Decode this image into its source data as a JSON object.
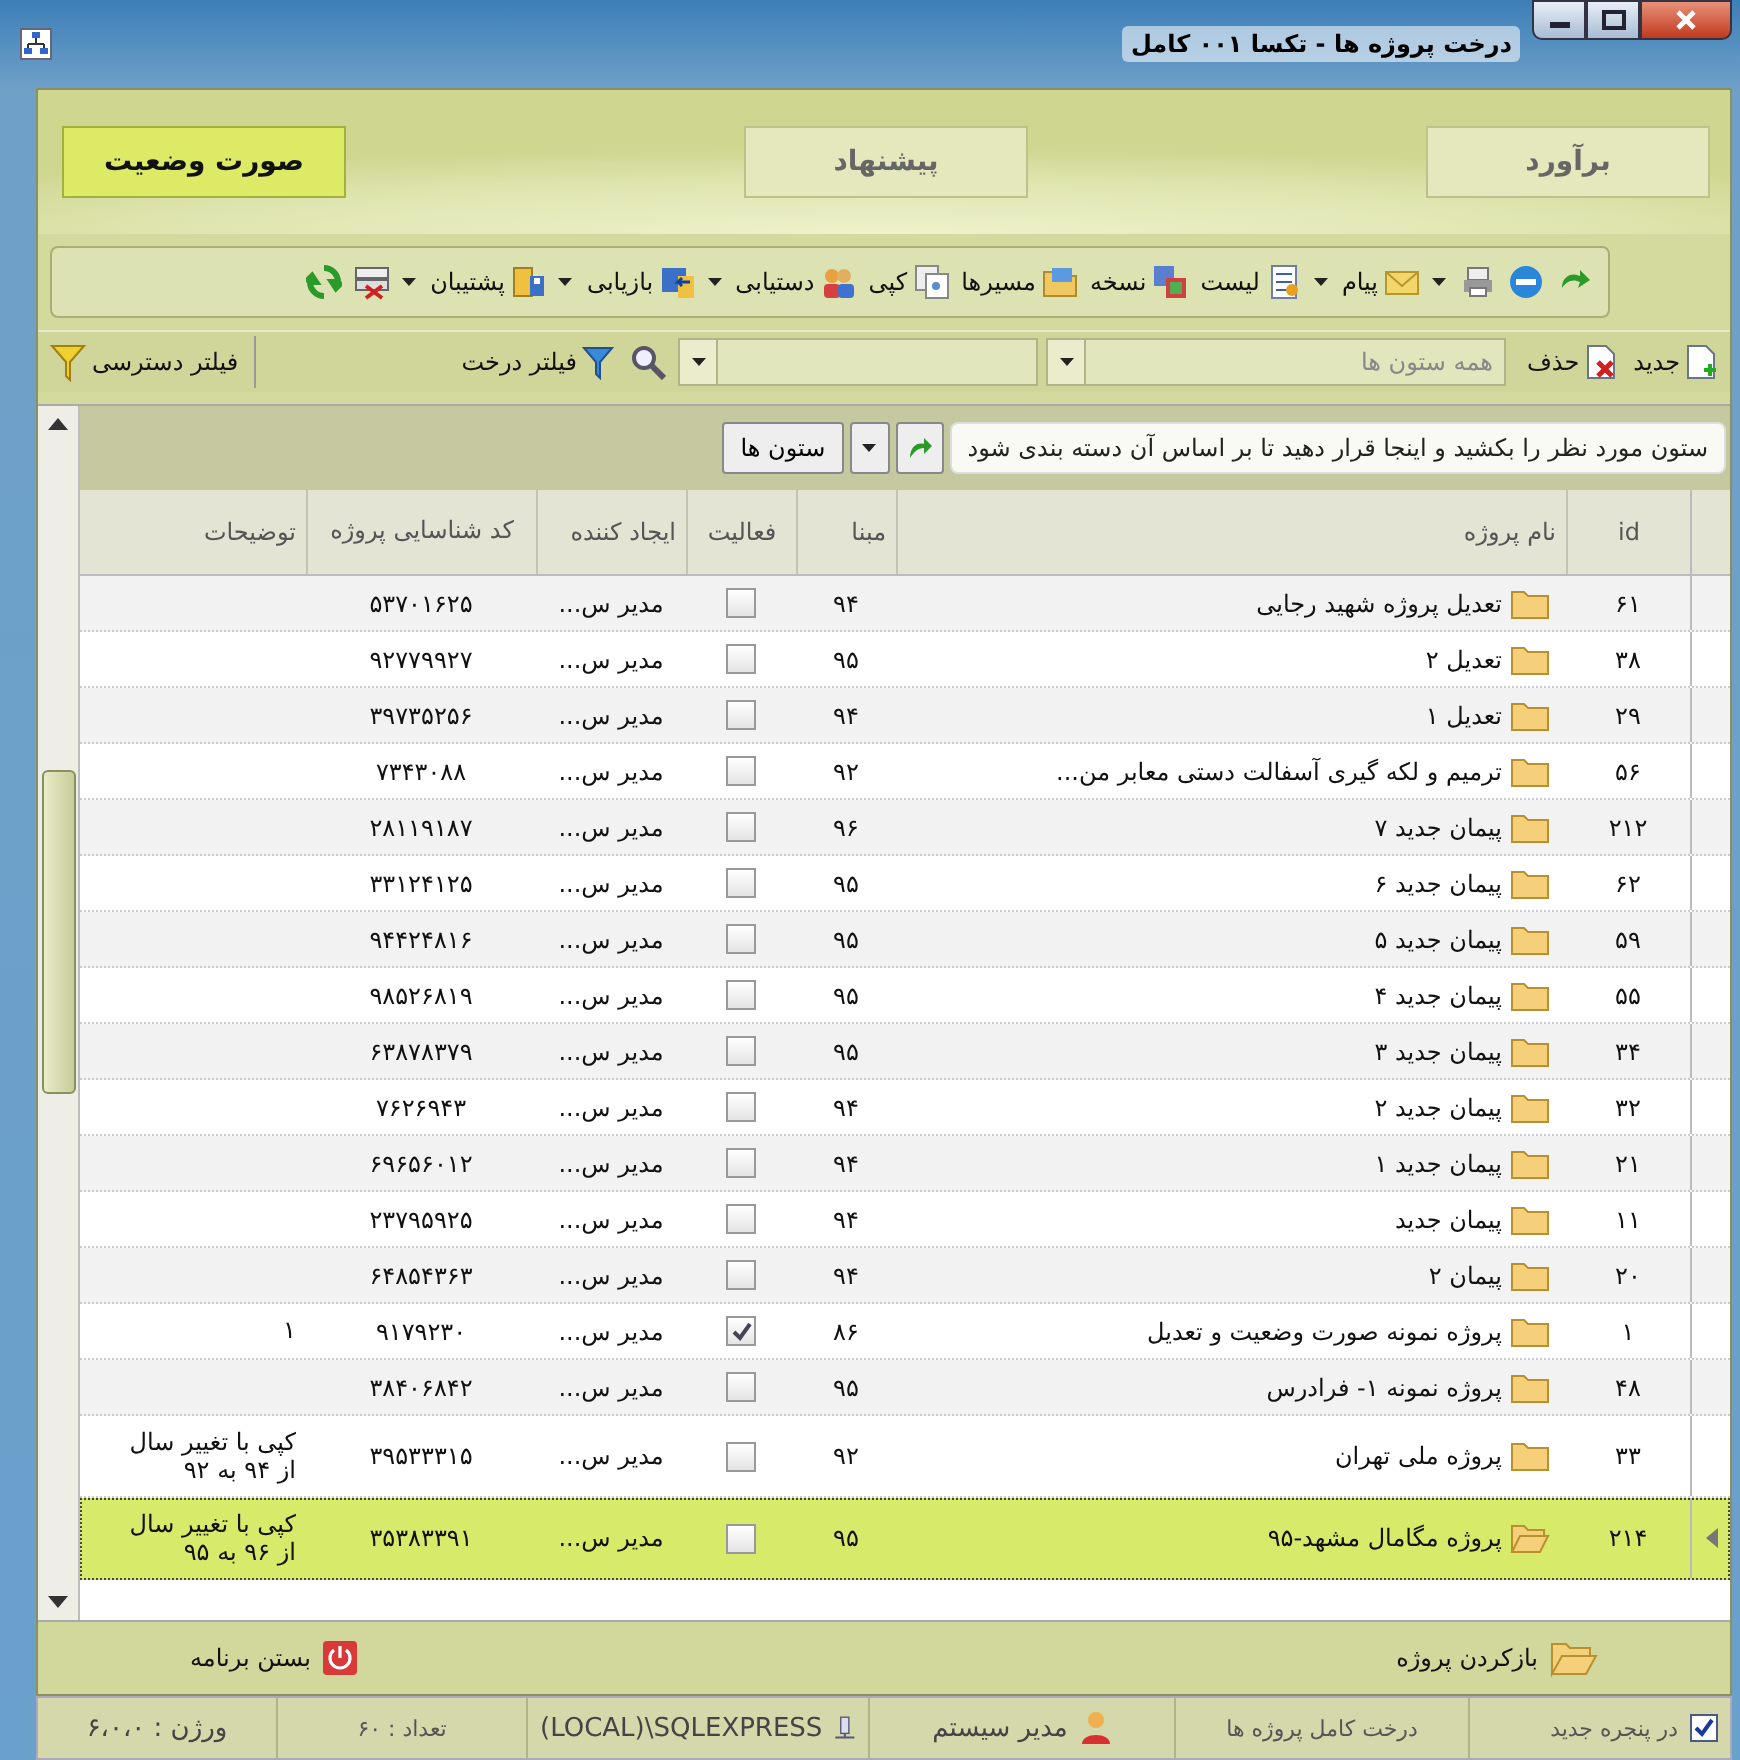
{
  "window": {
    "title": "درخت پروژه ها - تکسا ۰۰۱ کامل"
  },
  "modes": [
    {
      "label": "برآورد",
      "selected": false
    },
    {
      "label": "پیشنهاد",
      "selected": false
    },
    {
      "label": "صورت وضعیت",
      "selected": true
    }
  ],
  "toolbar": [
    {
      "dropdown": false
    },
    {
      "dropdown": false
    },
    {
      "dropdown": true
    },
    {
      "label": "پیام",
      "dropdown": true
    },
    {
      "label": "لیست",
      "dropdown": false
    },
    {
      "label": "نسخه",
      "dropdown": false
    },
    {
      "label": "مسیرها",
      "dropdown": false
    },
    {
      "label": "کپی",
      "dropdown": false
    },
    {
      "label": "دستیابی",
      "dropdown": true
    },
    {
      "label": "بازیابی",
      "dropdown": true
    },
    {
      "label": "پشتیبان",
      "dropdown": true
    },
    {
      "dropdown": false
    },
    {
      "dropdown": false
    }
  ],
  "filter_bar": {
    "new": "جدید",
    "delete": "حذف",
    "column_combo": {
      "placeholder": "همه ستون ها"
    },
    "tree_filter": "فیلتر درخت",
    "access_filter": "فیلتر دسترسی"
  },
  "group_panel": {
    "hint": "ستون مورد نظر را بکشید و اینجا قرار دهید تا بر اساس آن دسته بندی شود",
    "columns_button": "ستون ها"
  },
  "table": {
    "columns": [
      "id",
      "نام پروژه",
      "مبنا",
      "فعالیت",
      "ایجاد کننده",
      "کد شناسایی پروژه",
      "توضیحات"
    ],
    "rows": [
      {
        "id": "۶۱",
        "name": "تعدیل پروژه شهید رجایی",
        "basis": "۹۴",
        "creator": "مدیر س...",
        "active": false,
        "code": "۵۳۷۰۱۶۲۵",
        "selected": false
      },
      {
        "id": "۳۸",
        "name": "تعدیل ۲",
        "basis": "۹۵",
        "creator": "مدیر س...",
        "active": false,
        "code": "۹۲۷۷۹۹۲۷",
        "selected": false
      },
      {
        "id": "۲۹",
        "name": "تعدیل ۱",
        "basis": "۹۴",
        "creator": "مدیر س...",
        "active": false,
        "code": "۳۹۷۳۵۲۵۶",
        "selected": false
      },
      {
        "id": "۵۶",
        "name": "ترمیم و لکه گیری آسفالت دستی معابر من...",
        "basis": "۹۲",
        "creator": "مدیر س...",
        "active": false,
        "code": "۷۳۴۳۰۸۸",
        "selected": false
      },
      {
        "id": "۲۱۲",
        "name": "پیمان جدید ۷",
        "basis": "۹۶",
        "creator": "مدیر س...",
        "active": false,
        "code": "۲۸۱۱۹۱۸۷",
        "selected": false
      },
      {
        "id": "۶۲",
        "name": "پیمان جدید ۶",
        "basis": "۹۵",
        "creator": "مدیر س...",
        "active": false,
        "code": "۳۳۱۲۴۱۲۵",
        "selected": false
      },
      {
        "id": "۵۹",
        "name": "پیمان جدید ۵",
        "basis": "۹۵",
        "creator": "مدیر س...",
        "active": false,
        "code": "۹۴۴۲۴۸۱۶",
        "selected": false
      },
      {
        "id": "۵۵",
        "name": "پیمان جدید ۴",
        "basis": "۹۵",
        "creator": "مدیر س...",
        "active": false,
        "code": "۹۸۵۲۶۸۱۹",
        "selected": false
      },
      {
        "id": "۳۴",
        "name": "پیمان جدید ۳",
        "basis": "۹۵",
        "creator": "مدیر س...",
        "active": false,
        "code": "۶۳۸۷۸۳۷۹",
        "selected": false
      },
      {
        "id": "۳۲",
        "name": "پیمان جدید ۲",
        "basis": "۹۴",
        "creator": "مدیر س...",
        "active": false,
        "code": "۷۶۲۶۹۴۳",
        "selected": false
      },
      {
        "id": "۲۱",
        "name": "پیمان جدید ۱",
        "basis": "۹۴",
        "creator": "مدیر س...",
        "active": false,
        "code": "۶۹۶۵۶۰۱۲",
        "selected": false
      },
      {
        "id": "۱۱",
        "name": "پیمان جدید",
        "basis": "۹۴",
        "creator": "مدیر س...",
        "active": false,
        "code": "۲۳۷۹۵۹۲۵",
        "selected": false
      },
      {
        "id": "۲۰",
        "name": "پیمان ۲",
        "basis": "۹۴",
        "creator": "مدیر س...",
        "active": false,
        "code": "۶۴۸۵۴۳۶۳",
        "selected": false
      },
      {
        "id": "۱",
        "name": "پروژه نمونه صورت وضعیت و تعدیل",
        "basis": "۸۶",
        "creator": "مدیر س...",
        "active": true,
        "code": "۹۱۷۹۲۳۰",
        "notes": "۱",
        "selected": false
      },
      {
        "id": "۴۸",
        "name": "پروژه نمونه ۱- فرادرس",
        "basis": "۹۵",
        "creator": "مدیر س...",
        "active": false,
        "code": "۳۸۴۰۶۸۴۲",
        "selected": false
      },
      {
        "id": "۳۳",
        "name": "پروژه ملی تهران",
        "basis": "۹۲",
        "creator": "مدیر س...",
        "active": false,
        "code": "۳۹۵۳۳۳۱۵",
        "notes": "کپی با تغییر سال\nاز ۹۴ به ۹۲",
        "selected": false
      },
      {
        "id": "۲۱۴",
        "name": "پروژه مگامال مشهد-۹۵",
        "basis": "۹۵",
        "creator": "مدیر س...",
        "active": false,
        "code": "۳۵۳۸۳۳۹۱",
        "notes": "کپی با تغییر سال\nاز ۹۶ به ۹۵",
        "selected": true
      }
    ]
  },
  "actions": {
    "open": "بازکردن پروژه",
    "close": "بستن برنامه"
  },
  "status_bar": {
    "new_window": {
      "label": "در پنجره جدید",
      "checked": true
    },
    "view": "درخت کامل پروژه ها",
    "user": "مدیر سیستم",
    "server": "(LOCAL)\\SQLEXPRESS",
    "count": "تعداد : ۶۰",
    "version": "ورژن : ۶،۰،۰"
  }
}
